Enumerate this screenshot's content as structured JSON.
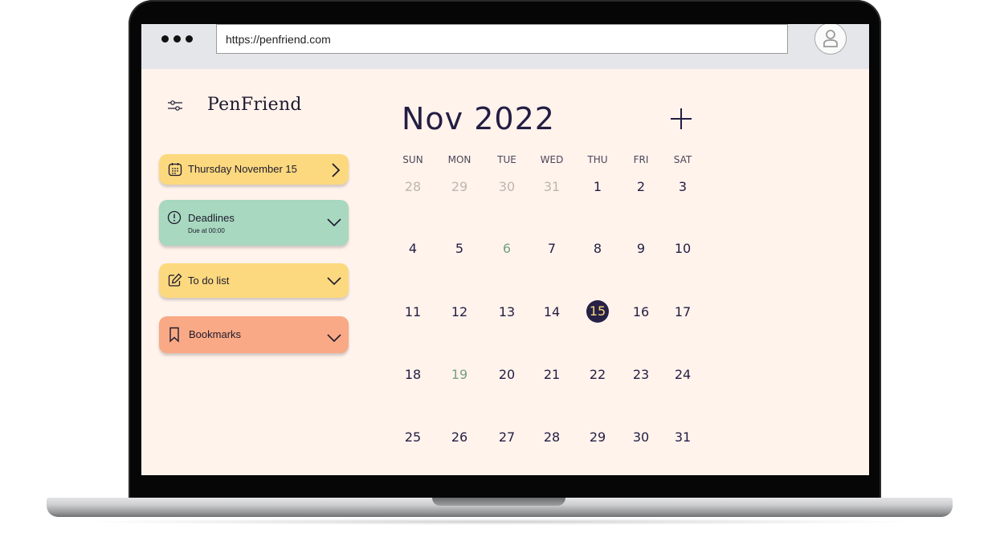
{
  "browser": {
    "url": "https://penfriend.com"
  },
  "app": {
    "name": "PenFriend"
  },
  "sidebar": {
    "cards": [
      {
        "label": "Thursday November 15"
      },
      {
        "label": "Deadlines",
        "sub": "Due at 00:00"
      },
      {
        "label": "To do list"
      },
      {
        "label": "Bookmarks"
      }
    ]
  },
  "calendar": {
    "month_label": "Nov 2022",
    "weekdays": [
      "SUN",
      "MON",
      "TUE",
      "WED",
      "THU",
      "FRI",
      "SAT"
    ],
    "selected_day": "15",
    "weeks": [
      [
        {
          "d": "28",
          "s": "muted"
        },
        {
          "d": "29",
          "s": "muted"
        },
        {
          "d": "30",
          "s": "muted"
        },
        {
          "d": "31",
          "s": "muted"
        },
        {
          "d": "1",
          "s": ""
        },
        {
          "d": "2",
          "s": ""
        },
        {
          "d": "3",
          "s": ""
        }
      ],
      [
        {
          "d": "4",
          "s": ""
        },
        {
          "d": "5",
          "s": ""
        },
        {
          "d": "6",
          "s": "green"
        },
        {
          "d": "7",
          "s": ""
        },
        {
          "d": "8",
          "s": ""
        },
        {
          "d": "9",
          "s": ""
        },
        {
          "d": "10",
          "s": ""
        }
      ],
      [
        {
          "d": "11",
          "s": ""
        },
        {
          "d": "12",
          "s": ""
        },
        {
          "d": "13",
          "s": ""
        },
        {
          "d": "14",
          "s": ""
        },
        {
          "d": "15",
          "s": "today"
        },
        {
          "d": "16",
          "s": ""
        },
        {
          "d": "17",
          "s": ""
        }
      ],
      [
        {
          "d": "18",
          "s": ""
        },
        {
          "d": "19",
          "s": "green"
        },
        {
          "d": "20",
          "s": ""
        },
        {
          "d": "21",
          "s": ""
        },
        {
          "d": "22",
          "s": ""
        },
        {
          "d": "23",
          "s": ""
        },
        {
          "d": "24",
          "s": ""
        }
      ],
      [
        {
          "d": "25",
          "s": ""
        },
        {
          "d": "26",
          "s": ""
        },
        {
          "d": "27",
          "s": ""
        },
        {
          "d": "28",
          "s": ""
        },
        {
          "d": "29",
          "s": ""
        },
        {
          "d": "30",
          "s": ""
        },
        {
          "d": "31",
          "s": ""
        }
      ]
    ]
  },
  "colors": {
    "background": "#fff3ec",
    "yellow_card": "#fcd97f",
    "green_card": "#a8d8bf",
    "orange_card": "#f9a985",
    "ink": "#231d42"
  },
  "icons": [
    "menu-dots-icon",
    "user-icon",
    "sliders-icon",
    "calendar-icon",
    "alert-circle-icon",
    "edit-icon",
    "bookmark-icon",
    "chevron-right-icon",
    "chevron-down-icon",
    "plus-icon"
  ]
}
